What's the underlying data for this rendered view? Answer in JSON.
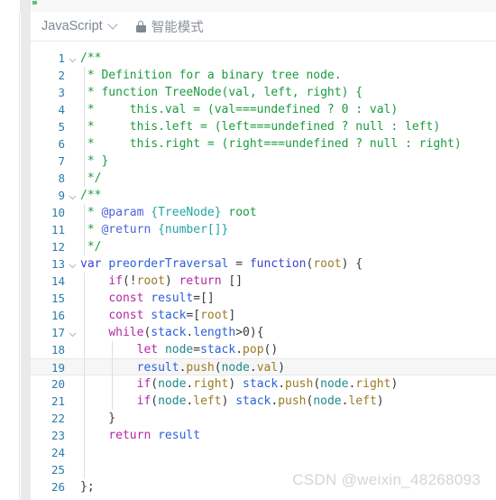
{
  "toolbar": {
    "language": "JavaScript",
    "language_chevron_icon": "chevron-down-icon",
    "lock_icon": "lock-icon",
    "mode_label": "智能模式"
  },
  "editor": {
    "language_mode": "javascript",
    "active_line": 19,
    "total_lines": 26,
    "colors": {
      "background": "#ffffff",
      "gutter_number": "#2a7ca8",
      "comment": "#1a9c3e",
      "keyword": "#b427a5",
      "keyword_declaration": "#3c41d8",
      "identifier": "#9a7a22",
      "variable": "#2b61d8",
      "jsdoc_tag": "#4b63d8",
      "jsdoc_type": "#22a5a5",
      "active_line_background": "#f6f6f6"
    },
    "lines": [
      {
        "n": 1,
        "fold": true,
        "text": "/**"
      },
      {
        "n": 2,
        "fold": false,
        "text": " * Definition for a binary tree node."
      },
      {
        "n": 3,
        "fold": false,
        "text": " * function TreeNode(val, left, right) {"
      },
      {
        "n": 4,
        "fold": false,
        "text": " *     this.val = (val===undefined ? 0 : val)"
      },
      {
        "n": 5,
        "fold": false,
        "text": " *     this.left = (left===undefined ? null : left)"
      },
      {
        "n": 6,
        "fold": false,
        "text": " *     this.right = (right===undefined ? null : right)"
      },
      {
        "n": 7,
        "fold": false,
        "text": " * }"
      },
      {
        "n": 8,
        "fold": false,
        "text": " */"
      },
      {
        "n": 9,
        "fold": true,
        "text": "/**"
      },
      {
        "n": 10,
        "fold": false,
        "text": " * @param {TreeNode} root"
      },
      {
        "n": 11,
        "fold": false,
        "text": " * @return {number[]}"
      },
      {
        "n": 12,
        "fold": false,
        "text": " */"
      },
      {
        "n": 13,
        "fold": true,
        "text": "var preorderTraversal = function(root) {"
      },
      {
        "n": 14,
        "fold": false,
        "text": "    if(!root) return []"
      },
      {
        "n": 15,
        "fold": false,
        "text": "    const result=[]"
      },
      {
        "n": 16,
        "fold": false,
        "text": "    const stack=[root]"
      },
      {
        "n": 17,
        "fold": true,
        "text": "    while(stack.length>0){"
      },
      {
        "n": 18,
        "fold": false,
        "text": "        let node=stack.pop()"
      },
      {
        "n": 19,
        "fold": false,
        "text": "        result.push(node.val)"
      },
      {
        "n": 20,
        "fold": false,
        "text": "        if(node.right) stack.push(node.right)"
      },
      {
        "n": 21,
        "fold": false,
        "text": "        if(node.left) stack.push(node.left)"
      },
      {
        "n": 22,
        "fold": false,
        "text": "    }"
      },
      {
        "n": 23,
        "fold": false,
        "text": "    return result"
      },
      {
        "n": 24,
        "fold": false,
        "text": ""
      },
      {
        "n": 25,
        "fold": false,
        "text": ""
      },
      {
        "n": 26,
        "fold": false,
        "text": "};"
      }
    ]
  },
  "watermark": {
    "text": "CSDN @weixin_48268093"
  }
}
